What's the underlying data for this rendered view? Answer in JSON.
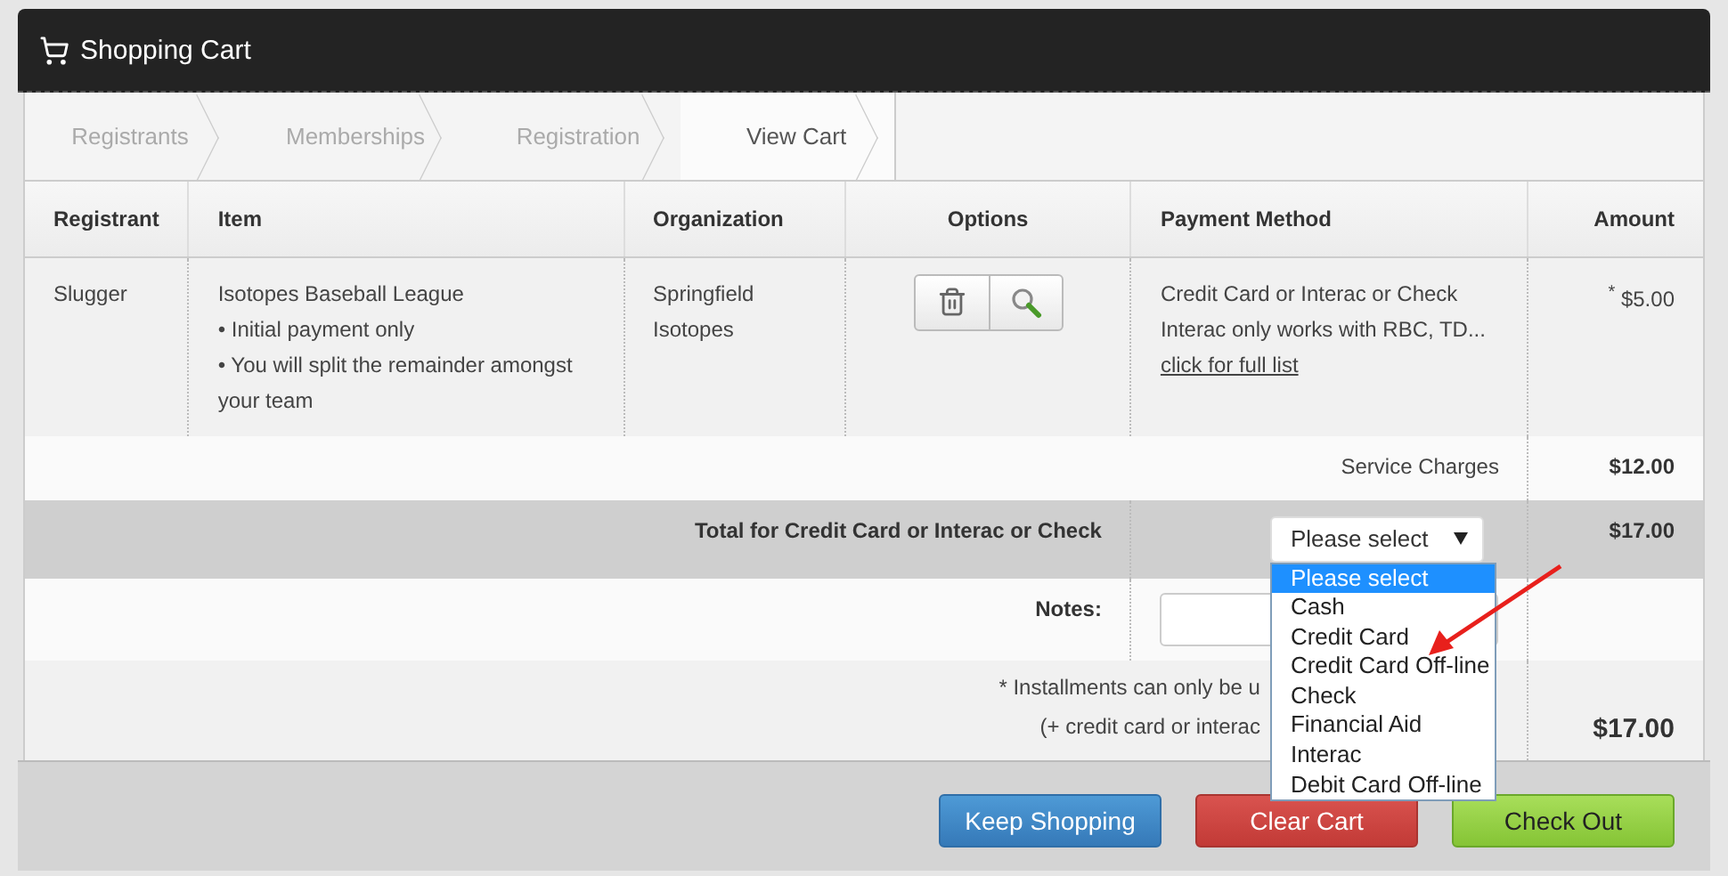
{
  "header": {
    "title": "Shopping Cart"
  },
  "steps": [
    {
      "label": "Registrants",
      "selected": false
    },
    {
      "label": "Memberships",
      "selected": false
    },
    {
      "label": "Registration",
      "selected": false
    },
    {
      "label": "View Cart",
      "selected": true
    }
  ],
  "table": {
    "columns": [
      "Registrant",
      "Item",
      "Organization",
      "Options",
      "Payment Method",
      "Amount"
    ],
    "rows": [
      {
        "registrant": "Slugger",
        "item": {
          "name": "Isotopes Baseball League",
          "notes": [
            "• Initial payment only",
            "• You will split the remainder amongst your team"
          ]
        },
        "organization": "Springfield Isotopes",
        "payment": {
          "methods": "Credit Card or Interac or Check",
          "note": "Interac only works with RBC, TD...",
          "link": "click for full list"
        },
        "amount": "$^{*}$ $5.00"
      }
    ]
  },
  "service_charges": {
    "label": "Service Charges",
    "amount": "$12.00"
  },
  "total": {
    "label": "Total for Credit Card or Interac or Check",
    "amount": "$17.00",
    "select": {
      "value": "Please select",
      "options": [
        {
          "label": "Please select",
          "selected": true
        },
        {
          "label": "Cash",
          "selected": false
        },
        {
          "label": "Credit Card",
          "selected": false
        },
        {
          "label": "Credit Card Off-line",
          "selected": false
        },
        {
          "label": "Check",
          "selected": false
        },
        {
          "label": "Financial Aid",
          "selected": false
        },
        {
          "label": "Interac",
          "selected": false
        },
        {
          "label": "Debit Card Off-line",
          "selected": false
        }
      ]
    }
  },
  "notes": {
    "label": "Notes:"
  },
  "footnote": {
    "lines": [
      "* Installments can only be u",
      "(+ credit card or interac"
    ],
    "amount": "$17.00"
  },
  "buttons": [
    {
      "label": "Keep Shopping",
      "kind": "keep"
    },
    {
      "label": "Clear Cart",
      "kind": "clear"
    },
    {
      "label": "Check Out",
      "kind": "checkout"
    }
  ]
}
